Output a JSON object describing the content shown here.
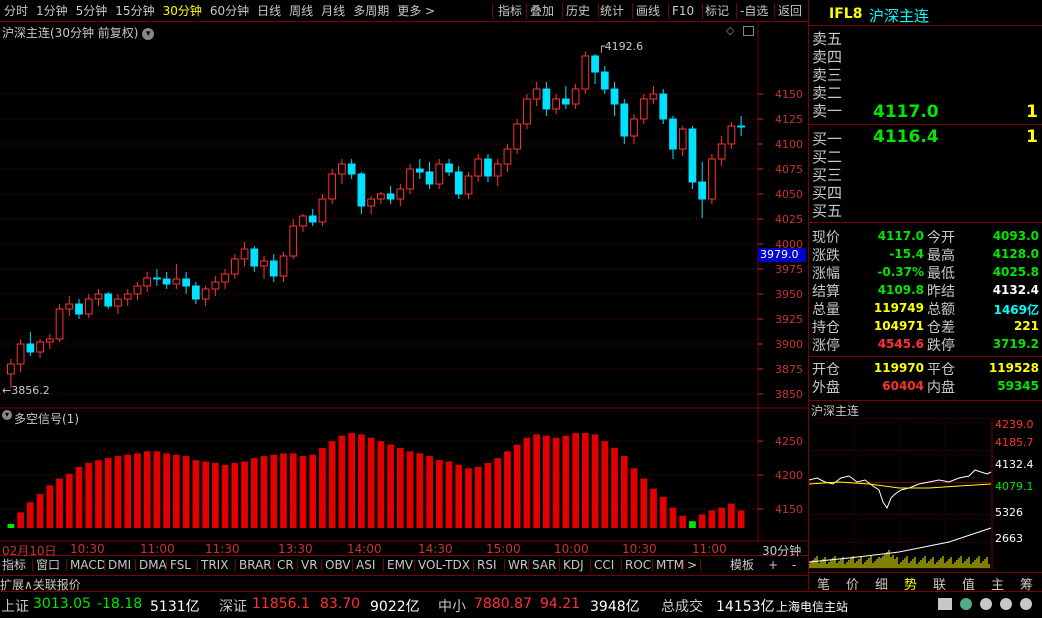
{
  "topbar": {
    "periods": [
      "分时",
      "1分钟",
      "5分钟",
      "15分钟",
      "30分钟",
      "60分钟",
      "日线",
      "周线",
      "月线",
      "多周期",
      "更多 >"
    ],
    "active": "30分钟",
    "tools": [
      "指标",
      "叠加",
      "历史",
      "统计",
      "画线",
      "F10",
      "标记",
      "-自选",
      "返回"
    ]
  },
  "chart": {
    "title": "沪深主连(30分钟 前复权)",
    "high_label": "4192.6",
    "low_label": "3856.2",
    "cursor_value": "3979.0",
    "yticks": [
      "4150",
      "4125",
      "4100",
      "4075",
      "4050",
      "4025",
      "4000",
      "3975",
      "3950",
      "3925",
      "3900",
      "3875",
      "3850"
    ],
    "ytick_values": [
      4150,
      4125,
      4100,
      4075,
      4050,
      4025,
      4000,
      3975,
      3950,
      3925,
      3900,
      3875,
      3850
    ],
    "ymin": 3842,
    "ymax": 4212
  },
  "sub_chart": {
    "title": "多空信号(1)",
    "yticks": [
      "4250",
      "4200",
      "4150"
    ],
    "ytick_values": [
      4250,
      4200,
      4150
    ],
    "ymin": 4122,
    "ymax": 4290
  },
  "time_axis": {
    "labels": [
      "02月10日",
      "10:30",
      "11:00",
      "11:30",
      "13:30",
      "14:00",
      "14:30",
      "15:00",
      "10:00",
      "10:30",
      "11:00"
    ],
    "period": "30分钟"
  },
  "bottom_tabs": [
    "指标",
    "窗口",
    "MACD",
    "DMI",
    "DMA",
    "FSL",
    "TRIX",
    "BRAR",
    "CR",
    "VR",
    "OBV",
    "ASI",
    "EMV",
    "VOL-TDX",
    "RSI",
    "WR",
    "SAR",
    "KDJ",
    "CCI",
    "ROC",
    "MTM",
    ">"
  ],
  "bottom_tabs2": [
    "扩展∧",
    "关联报价"
  ],
  "template_label": "模板",
  "plus_label": "+",
  "minus_label": "-",
  "quote": {
    "code": "IFL8",
    "name": "沪深主连",
    "sell_labels": [
      "卖五",
      "卖四",
      "卖三",
      "卖二",
      "卖一"
    ],
    "buy_labels": [
      "买一",
      "买二",
      "买三",
      "买四",
      "买五"
    ],
    "sell1_price": "4117.0",
    "sell1_vol": "1",
    "buy1_price": "4116.4",
    "buy1_vol": "1",
    "rows": [
      {
        "l1": "现价",
        "v1": "4117.0",
        "c1": "green",
        "l2": "今开",
        "v2": "4093.0",
        "c2": "green"
      },
      {
        "l1": "涨跌",
        "v1": "-15.4",
        "c1": "green",
        "l2": "最高",
        "v2": "4128.0",
        "c2": "green"
      },
      {
        "l1": "涨幅",
        "v1": "-0.37%",
        "c1": "green",
        "l2": "最低",
        "v2": "4025.8",
        "c2": "green"
      },
      {
        "l1": "结算",
        "v1": "4109.8",
        "c1": "green",
        "l2": "昨结",
        "v2": "4132.4",
        "c2": "white"
      },
      {
        "l1": "总量",
        "v1": "119749",
        "c1": "yellow",
        "l2": "总额",
        "v2": "1469亿",
        "c2": "cyan"
      },
      {
        "l1": "持仓",
        "v1": "104971",
        "c1": "yellow",
        "l2": "仓差",
        "v2": "221",
        "c2": "yellow"
      },
      {
        "l1": "涨停",
        "v1": "4545.6",
        "c1": "red",
        "l2": "跌停",
        "v2": "3719.2",
        "c2": "green"
      }
    ],
    "rows2": [
      {
        "l1": "开仓",
        "v1": "119970",
        "c1": "yellow",
        "l2": "平仓",
        "v2": "119528",
        "c2": "yellow"
      },
      {
        "l1": "外盘",
        "v1": "60404",
        "c1": "red",
        "l2": "内盘",
        "v2": "59345",
        "c2": "green"
      }
    ],
    "mini_title": "沪深主连",
    "mini_prices": [
      "4239.0",
      "4185.7",
      "4132.4",
      "4079.1"
    ],
    "mini_vols": [
      "5326",
      "2663"
    ],
    "right_tabs": [
      "笔",
      "价",
      "细",
      "势",
      "联",
      "值",
      "主",
      "筹"
    ],
    "right_tab_active": "势"
  },
  "status": {
    "sh_label": "上证",
    "sh_val": "3013.05",
    "sh_chg": "-18.18",
    "sh_amt": "5131亿",
    "sz_label": "深证",
    "sz_val": "11856.1",
    "sz_chg": "83.70",
    "sz_amt": "9022亿",
    "zx_label": "中小",
    "zx_val": "7880.87",
    "zx_chg": "94.21",
    "zx_amt": "3948亿",
    "total_label": "总成交",
    "total_val": "14153亿",
    "site": "上海电信主站"
  },
  "colors": {
    "up": "#ff3232",
    "down": "#00e0ff",
    "grid": "#7a0000",
    "axis": "#c83232",
    "bar": "#e00000"
  },
  "chart_data": {
    "type": "candlestick",
    "candles": [
      [
        3870,
        3885,
        3856,
        3880
      ],
      [
        3880,
        3905,
        3872,
        3900
      ],
      [
        3900,
        3912,
        3888,
        3892
      ],
      [
        3892,
        3905,
        3886,
        3902
      ],
      [
        3902,
        3910,
        3895,
        3905
      ],
      [
        3905,
        3940,
        3902,
        3935
      ],
      [
        3935,
        3948,
        3928,
        3940
      ],
      [
        3940,
        3945,
        3925,
        3930
      ],
      [
        3930,
        3950,
        3926,
        3945
      ],
      [
        3945,
        3955,
        3938,
        3950
      ],
      [
        3950,
        3952,
        3935,
        3938
      ],
      [
        3938,
        3950,
        3930,
        3945
      ],
      [
        3945,
        3955,
        3938,
        3950
      ],
      [
        3950,
        3962,
        3944,
        3958
      ],
      [
        3958,
        3972,
        3952,
        3966
      ],
      [
        3966,
        3975,
        3958,
        3965
      ],
      [
        3965,
        3972,
        3955,
        3960
      ],
      [
        3960,
        3980,
        3955,
        3965
      ],
      [
        3965,
        3972,
        3950,
        3958
      ],
      [
        3958,
        3962,
        3940,
        3945
      ],
      [
        3945,
        3958,
        3938,
        3955
      ],
      [
        3955,
        3968,
        3948,
        3962
      ],
      [
        3962,
        3975,
        3955,
        3970
      ],
      [
        3970,
        3990,
        3965,
        3985
      ],
      [
        3985,
        4002,
        3978,
        3995
      ],
      [
        3995,
        3998,
        3972,
        3978
      ],
      [
        3978,
        3988,
        3965,
        3983
      ],
      [
        3983,
        3990,
        3962,
        3968
      ],
      [
        3968,
        3992,
        3962,
        3988
      ],
      [
        3988,
        4025,
        3985,
        4018
      ],
      [
        4018,
        4030,
        4012,
        4028
      ],
      [
        4028,
        4035,
        4018,
        4022
      ],
      [
        4022,
        4050,
        4018,
        4045
      ],
      [
        4045,
        4075,
        4040,
        4070
      ],
      [
        4070,
        4085,
        4060,
        4080
      ],
      [
        4080,
        4085,
        4065,
        4070
      ],
      [
        4070,
        4072,
        4030,
        4038
      ],
      [
        4038,
        4048,
        4030,
        4045
      ],
      [
        4045,
        4052,
        4040,
        4050
      ],
      [
        4050,
        4058,
        4040,
        4045
      ],
      [
        4045,
        4060,
        4038,
        4055
      ],
      [
        4055,
        4080,
        4050,
        4075
      ],
      [
        4075,
        4085,
        4065,
        4072
      ],
      [
        4072,
        4082,
        4055,
        4060
      ],
      [
        4060,
        4085,
        4055,
        4080
      ],
      [
        4080,
        4085,
        4068,
        4072
      ],
      [
        4072,
        4078,
        4045,
        4050
      ],
      [
        4050,
        4072,
        4045,
        4068
      ],
      [
        4068,
        4090,
        4062,
        4085
      ],
      [
        4085,
        4090,
        4062,
        4068
      ],
      [
        4068,
        4085,
        4058,
        4080
      ],
      [
        4080,
        4100,
        4072,
        4095
      ],
      [
        4095,
        4125,
        4090,
        4120
      ],
      [
        4120,
        4150,
        4115,
        4145
      ],
      [
        4145,
        4162,
        4138,
        4155
      ],
      [
        4155,
        4162,
        4128,
        4135
      ],
      [
        4135,
        4150,
        4130,
        4145
      ],
      [
        4145,
        4158,
        4135,
        4140
      ],
      [
        4140,
        4160,
        4135,
        4155
      ],
      [
        4155,
        4192.6,
        4150,
        4188
      ],
      [
        4188,
        4190,
        4160,
        4172
      ],
      [
        4172,
        4178,
        4150,
        4155
      ],
      [
        4155,
        4162,
        4128,
        4140
      ],
      [
        4140,
        4145,
        4100,
        4108
      ],
      [
        4108,
        4130,
        4100,
        4125
      ],
      [
        4125,
        4150,
        4120,
        4145
      ],
      [
        4145,
        4158,
        4140,
        4150
      ],
      [
        4150,
        4155,
        4120,
        4125
      ],
      [
        4125,
        4128,
        4085,
        4095
      ],
      [
        4095,
        4118,
        4088,
        4115
      ],
      [
        4115,
        4118,
        4055,
        4062
      ],
      [
        4062,
        4082,
        4025.8,
        4045
      ],
      [
        4045,
        4090,
        4040,
        4085
      ],
      [
        4085,
        4108,
        4078,
        4100
      ],
      [
        4100,
        4122,
        4095,
        4118
      ],
      [
        4118,
        4128,
        4108,
        4117
      ]
    ],
    "signal_bars": [
      4128,
      4145,
      4160,
      4172,
      4185,
      4195,
      4202,
      4212,
      4218,
      4222,
      4225,
      4228,
      4230,
      4232,
      4235,
      4235,
      4232,
      4230,
      4228,
      4222,
      4220,
      4218,
      4215,
      4218,
      4220,
      4225,
      4228,
      4230,
      4232,
      4232,
      4228,
      4230,
      4240,
      4250,
      4258,
      4262,
      4260,
      4255,
      4250,
      4245,
      4240,
      4235,
      4232,
      4228,
      4222,
      4220,
      4215,
      4210,
      4212,
      4218,
      4225,
      4235,
      4245,
      4255,
      4260,
      4258,
      4255,
      4258,
      4262,
      4262,
      4260,
      4250,
      4240,
      4228,
      4210,
      4195,
      4180,
      4168,
      4152,
      4140,
      4132,
      4142,
      4148,
      4152,
      4158,
      4148
    ],
    "ymin": 3842,
    "ymax": 4212
  }
}
